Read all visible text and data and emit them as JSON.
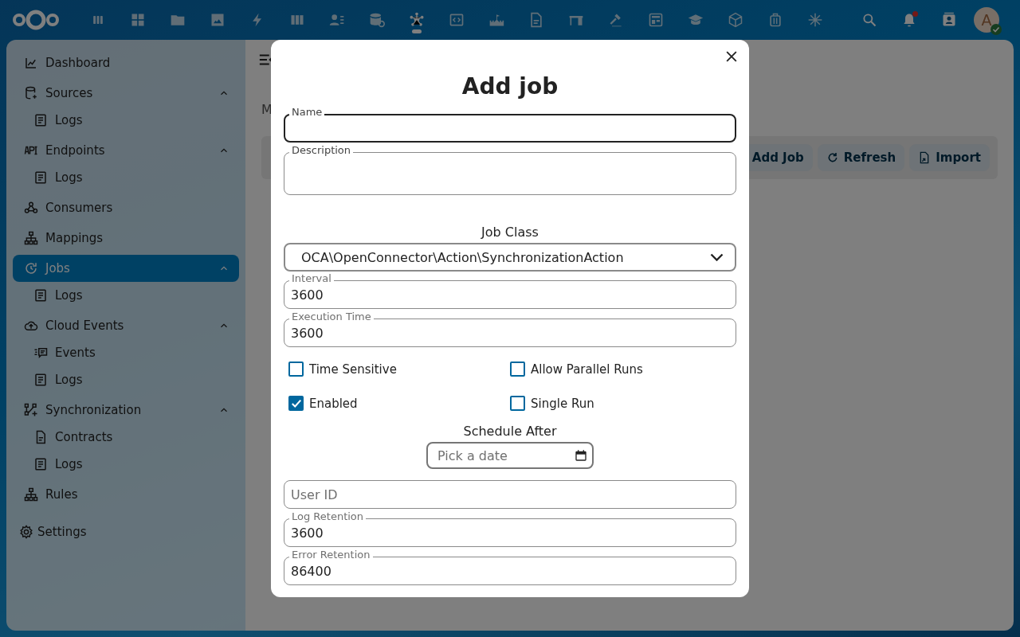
{
  "topbar": {
    "apps": [
      {
        "selected": false
      },
      {
        "selected": false
      },
      {
        "selected": false
      },
      {
        "selected": false
      },
      {
        "selected": false
      },
      {
        "selected": false
      },
      {
        "selected": false
      },
      {
        "selected": false
      },
      {
        "selected": true
      },
      {
        "selected": false
      },
      {
        "selected": false
      },
      {
        "selected": false
      },
      {
        "selected": false
      },
      {
        "selected": false
      },
      {
        "selected": false
      },
      {
        "selected": false
      },
      {
        "selected": false
      },
      {
        "selected": false
      },
      {
        "selected": false
      }
    ],
    "notifications_unread": true,
    "avatar": {
      "initial": "A",
      "online": true
    }
  },
  "sidebar": {
    "items": [
      {
        "label": "Dashboard",
        "selected": false
      },
      {
        "label": "Sources",
        "selected": false,
        "expanded": true,
        "children": [
          {
            "label": "Logs",
            "selected": false
          }
        ]
      },
      {
        "label": "Endpoints",
        "selected": false,
        "expanded": true,
        "children": [
          {
            "label": "Logs",
            "selected": false
          }
        ]
      },
      {
        "label": "Consumers",
        "selected": false
      },
      {
        "label": "Mappings",
        "selected": false
      },
      {
        "label": "Jobs",
        "selected": true,
        "expanded": true,
        "children": [
          {
            "label": "Logs",
            "selected": false
          }
        ]
      },
      {
        "label": "Cloud Events",
        "selected": false,
        "expanded": true,
        "children": [
          {
            "label": "Events",
            "selected": false
          },
          {
            "label": "Logs",
            "selected": false
          }
        ]
      },
      {
        "label": "Synchronization",
        "selected": false,
        "expanded": true,
        "children": [
          {
            "label": "Contracts",
            "selected": false
          },
          {
            "label": "Logs",
            "selected": false
          }
        ]
      },
      {
        "label": "Rules",
        "selected": false
      }
    ],
    "settings": {
      "label": "Settings"
    }
  },
  "content": {
    "heading": "M",
    "buttons": [
      {
        "label": "Add Job"
      },
      {
        "label": "Refresh"
      },
      {
        "label": "Import"
      }
    ]
  },
  "modal": {
    "title": "Add job",
    "fields": [
      {
        "kind": "text",
        "label": "Name",
        "focused": true
      },
      {
        "kind": "textarea",
        "label": "Description"
      },
      {
        "kind": "select",
        "label": "Job Class",
        "value": "OCA\\OpenConnector\\Action\\SynchronizationAction"
      },
      {
        "kind": "text",
        "label": "Interval",
        "value": "3600"
      },
      {
        "kind": "text",
        "label": "Execution Time",
        "value": "3600"
      },
      {
        "kind": "checkboxes",
        "items": [
          {
            "label": "Time Sensitive",
            "checked": false
          },
          {
            "label": "Allow Parallel Runs",
            "checked": false
          },
          {
            "label": "Enabled",
            "checked": true
          },
          {
            "label": "Single Run",
            "checked": false
          }
        ]
      },
      {
        "kind": "date",
        "label": "Schedule After",
        "placeholder": "Pick a date"
      },
      {
        "kind": "text",
        "placeholder": "User ID"
      },
      {
        "kind": "text",
        "label": "Log Retention",
        "value": "3600"
      },
      {
        "kind": "text",
        "label": "Error Retention",
        "value": "86400"
      }
    ]
  }
}
